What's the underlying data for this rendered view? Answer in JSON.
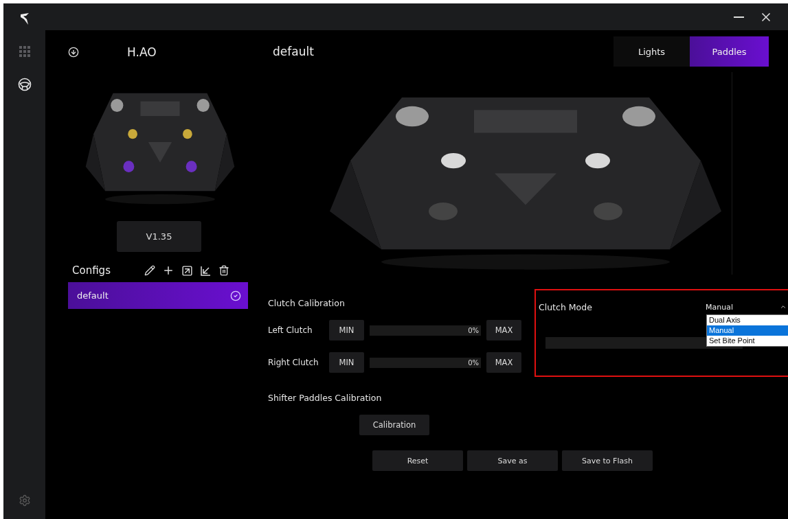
{
  "nav": [
    {
      "kind": "apps",
      "selected": false
    },
    {
      "kind": "wheel",
      "selected": true
    }
  ],
  "device": {
    "name": "H.AO",
    "firmware": "V1.35"
  },
  "configs": {
    "title": "Configs",
    "items": [
      {
        "label": "default",
        "selected": true
      }
    ]
  },
  "profile_title": "default",
  "tabs": [
    {
      "label": "Lights",
      "selected": false
    },
    {
      "label": "Paddles",
      "selected": true
    }
  ],
  "clutch_calibration": {
    "title": "Clutch Calibration",
    "rows": [
      {
        "label": "Left Clutch",
        "min": "MIN",
        "max": "MAX",
        "level": 0,
        "reading": "0%"
      },
      {
        "label": "Right Clutch",
        "min": "MIN",
        "max": "MAX",
        "level": 0,
        "reading": "0%"
      }
    ]
  },
  "clutch_mode": {
    "title": "Clutch Mode",
    "value": "Manual",
    "expanded": true,
    "level": 0,
    "options": [
      {
        "label": "Dual Axis",
        "selected": false
      },
      {
        "label": "Manual",
        "selected": true
      },
      {
        "label": "Set Bite Point",
        "selected": false
      }
    ]
  },
  "shifter": {
    "title": "Shifter Paddles Calibration",
    "button": "Calibration"
  },
  "actions": [
    "Reset",
    "Save as",
    "Save to Flash"
  ]
}
